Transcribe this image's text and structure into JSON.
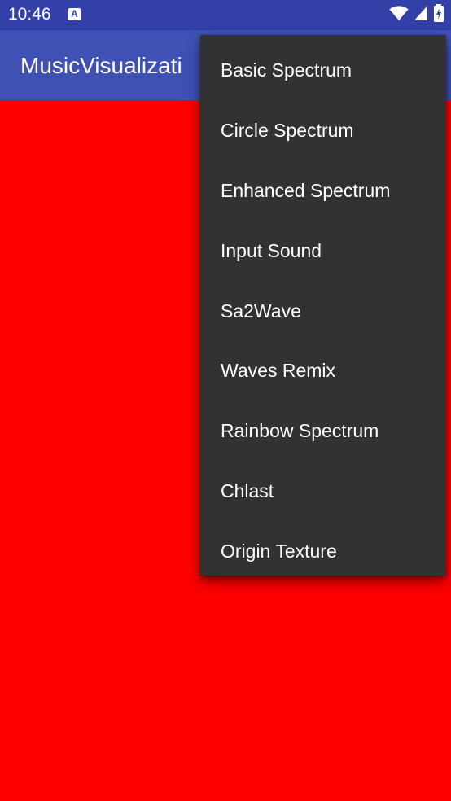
{
  "status_bar": {
    "time": "10:46",
    "notification_icon_letter": "A",
    "icons": [
      "wifi-icon",
      "signal-icon",
      "battery-icon"
    ],
    "color": "#3240a8"
  },
  "app_bar": {
    "title": "MusicVisualizati",
    "color": "#3f51b5"
  },
  "content": {
    "background": "#ff0000"
  },
  "menu": {
    "background": "#323232",
    "items": [
      {
        "label": "Basic Spectrum"
      },
      {
        "label": "Circle Spectrum"
      },
      {
        "label": "Enhanced Spectrum"
      },
      {
        "label": "Input Sound"
      },
      {
        "label": "Sa2Wave"
      },
      {
        "label": "Waves Remix"
      },
      {
        "label": "Rainbow Spectrum"
      },
      {
        "label": "Chlast"
      },
      {
        "label": "Origin Texture"
      }
    ]
  }
}
